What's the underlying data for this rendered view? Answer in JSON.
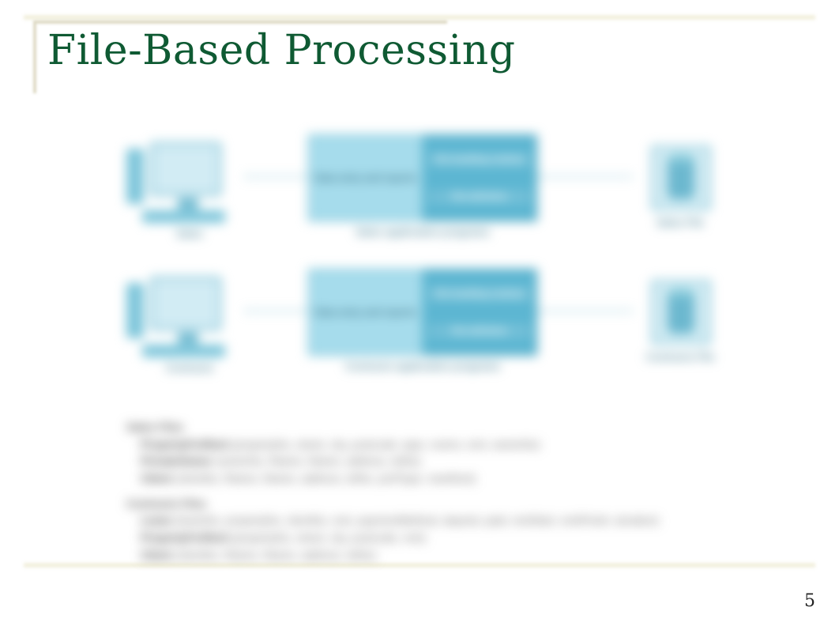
{
  "title": "File-Based Processing",
  "page_number": "5",
  "diagram": {
    "rows": [
      {
        "pc_label": "Sales",
        "app_left_text": "Data entry and reports",
        "app_right_top": "File handling routines",
        "app_right_bottom": "File definition",
        "app_caption": "Sales application programs",
        "file_label": "Sales File"
      },
      {
        "pc_label": "Contracts",
        "app_left_text": "Data entry and reports",
        "app_right_top": "File handling routines",
        "app_right_bottom": "File definition",
        "app_caption": "Contracts application programs",
        "file_label": "Contracts File"
      }
    ],
    "text": {
      "sales_header": "Sales Files",
      "sales_line1_b": "PropertyForRent",
      "sales_line1_r": "(propertyNo, street, city, postcode, type, rooms, rent, ownerNo)",
      "sales_line2_b": "PrivateOwner",
      "sales_line2_r": "(ownerNo, fName, lName, address, telNo)",
      "sales_line3_b": "Client",
      "sales_line3_r": "(clientNo, fName, lName, address, telNo, prefType, maxRent)",
      "contracts_header": "Contracts Files",
      "contracts_line1_b": "Lease",
      "contracts_line1_r": "(leaseNo, propertyNo, clientNo, rent, paymentMethod, deposit, paid, rentStart, rentFinish, duration)",
      "contracts_line2_b": "PropertyForRent",
      "contracts_line2_r": "(propertyNo, street, city, postcode, rent)",
      "contracts_line3_b": "Client",
      "contracts_line3_r": "(clientNo, fName, lName, address, telNo)"
    }
  }
}
